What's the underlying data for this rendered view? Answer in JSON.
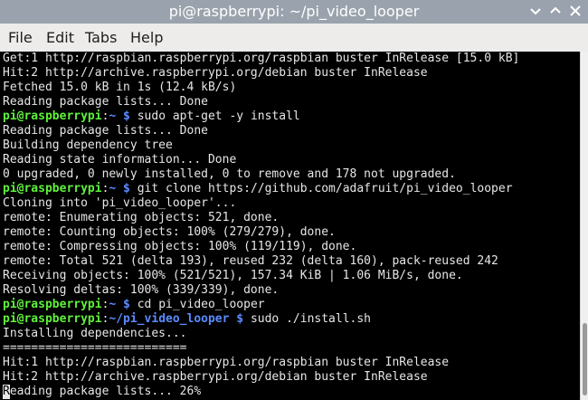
{
  "window": {
    "title": "pi@raspberrypi: ~/pi_video_looper"
  },
  "menu": {
    "file": "File",
    "edit": "Edit",
    "tabs": "Tabs",
    "help": "Help"
  },
  "terminal": {
    "lines": [
      {
        "type": "out",
        "text": "Get:1 http://raspbian.raspberrypi.org/raspbian buster InRelease [15.0 kB]"
      },
      {
        "type": "out",
        "text": "Hit:2 http://archive.raspberrypi.org/debian buster InRelease"
      },
      {
        "type": "out",
        "text": "Fetched 15.0 kB in 1s (12.4 kB/s)"
      },
      {
        "type": "out",
        "text": "Reading package lists... Done"
      },
      {
        "type": "cmd",
        "user": "pi@raspberrypi",
        "sep": ":",
        "path": "~ $",
        "cmd": " sudo apt-get -y install"
      },
      {
        "type": "out",
        "text": "Reading package lists... Done"
      },
      {
        "type": "out",
        "text": "Building dependency tree"
      },
      {
        "type": "out",
        "text": "Reading state information... Done"
      },
      {
        "type": "out",
        "text": "0 upgraded, 0 newly installed, 0 to remove and 178 not upgraded."
      },
      {
        "type": "cmd",
        "user": "pi@raspberrypi",
        "sep": ":",
        "path": "~ $",
        "cmd": " git clone https://github.com/adafruit/pi_video_looper"
      },
      {
        "type": "out",
        "text": "Cloning into 'pi_video_looper'..."
      },
      {
        "type": "out",
        "text": "remote: Enumerating objects: 521, done."
      },
      {
        "type": "out",
        "text": "remote: Counting objects: 100% (279/279), done."
      },
      {
        "type": "out",
        "text": "remote: Compressing objects: 100% (119/119), done."
      },
      {
        "type": "out",
        "text": "remote: Total 521 (delta 193), reused 232 (delta 160), pack-reused 242"
      },
      {
        "type": "out",
        "text": "Receiving objects: 100% (521/521), 157.34 KiB | 1.06 MiB/s, done."
      },
      {
        "type": "out",
        "text": "Resolving deltas: 100% (339/339), done."
      },
      {
        "type": "cmd",
        "user": "pi@raspberrypi",
        "sep": ":",
        "path": "~ $",
        "cmd": " cd pi_video_looper"
      },
      {
        "type": "cmd",
        "user": "pi@raspberrypi",
        "sep": ":",
        "path": "~/pi_video_looper $",
        "cmd": " sudo ./install.sh"
      },
      {
        "type": "out",
        "text": "Installing dependencies..."
      },
      {
        "type": "out",
        "text": "=========================="
      },
      {
        "type": "out",
        "text": "Hit:1 http://raspbian.raspberrypi.org/raspbian buster InRelease"
      },
      {
        "type": "out",
        "text": "Hit:2 http://archive.raspberrypi.org/debian buster InRelease"
      },
      {
        "type": "cursor",
        "cursor_char": "R",
        "text": "eading package lists... 26%"
      }
    ]
  },
  "colors": {
    "prompt_user": "#5ff23a",
    "prompt_path": "#5b8cff",
    "text": "#e6e6e6",
    "background": "#000000",
    "titlebar": "#9aa3ad"
  }
}
